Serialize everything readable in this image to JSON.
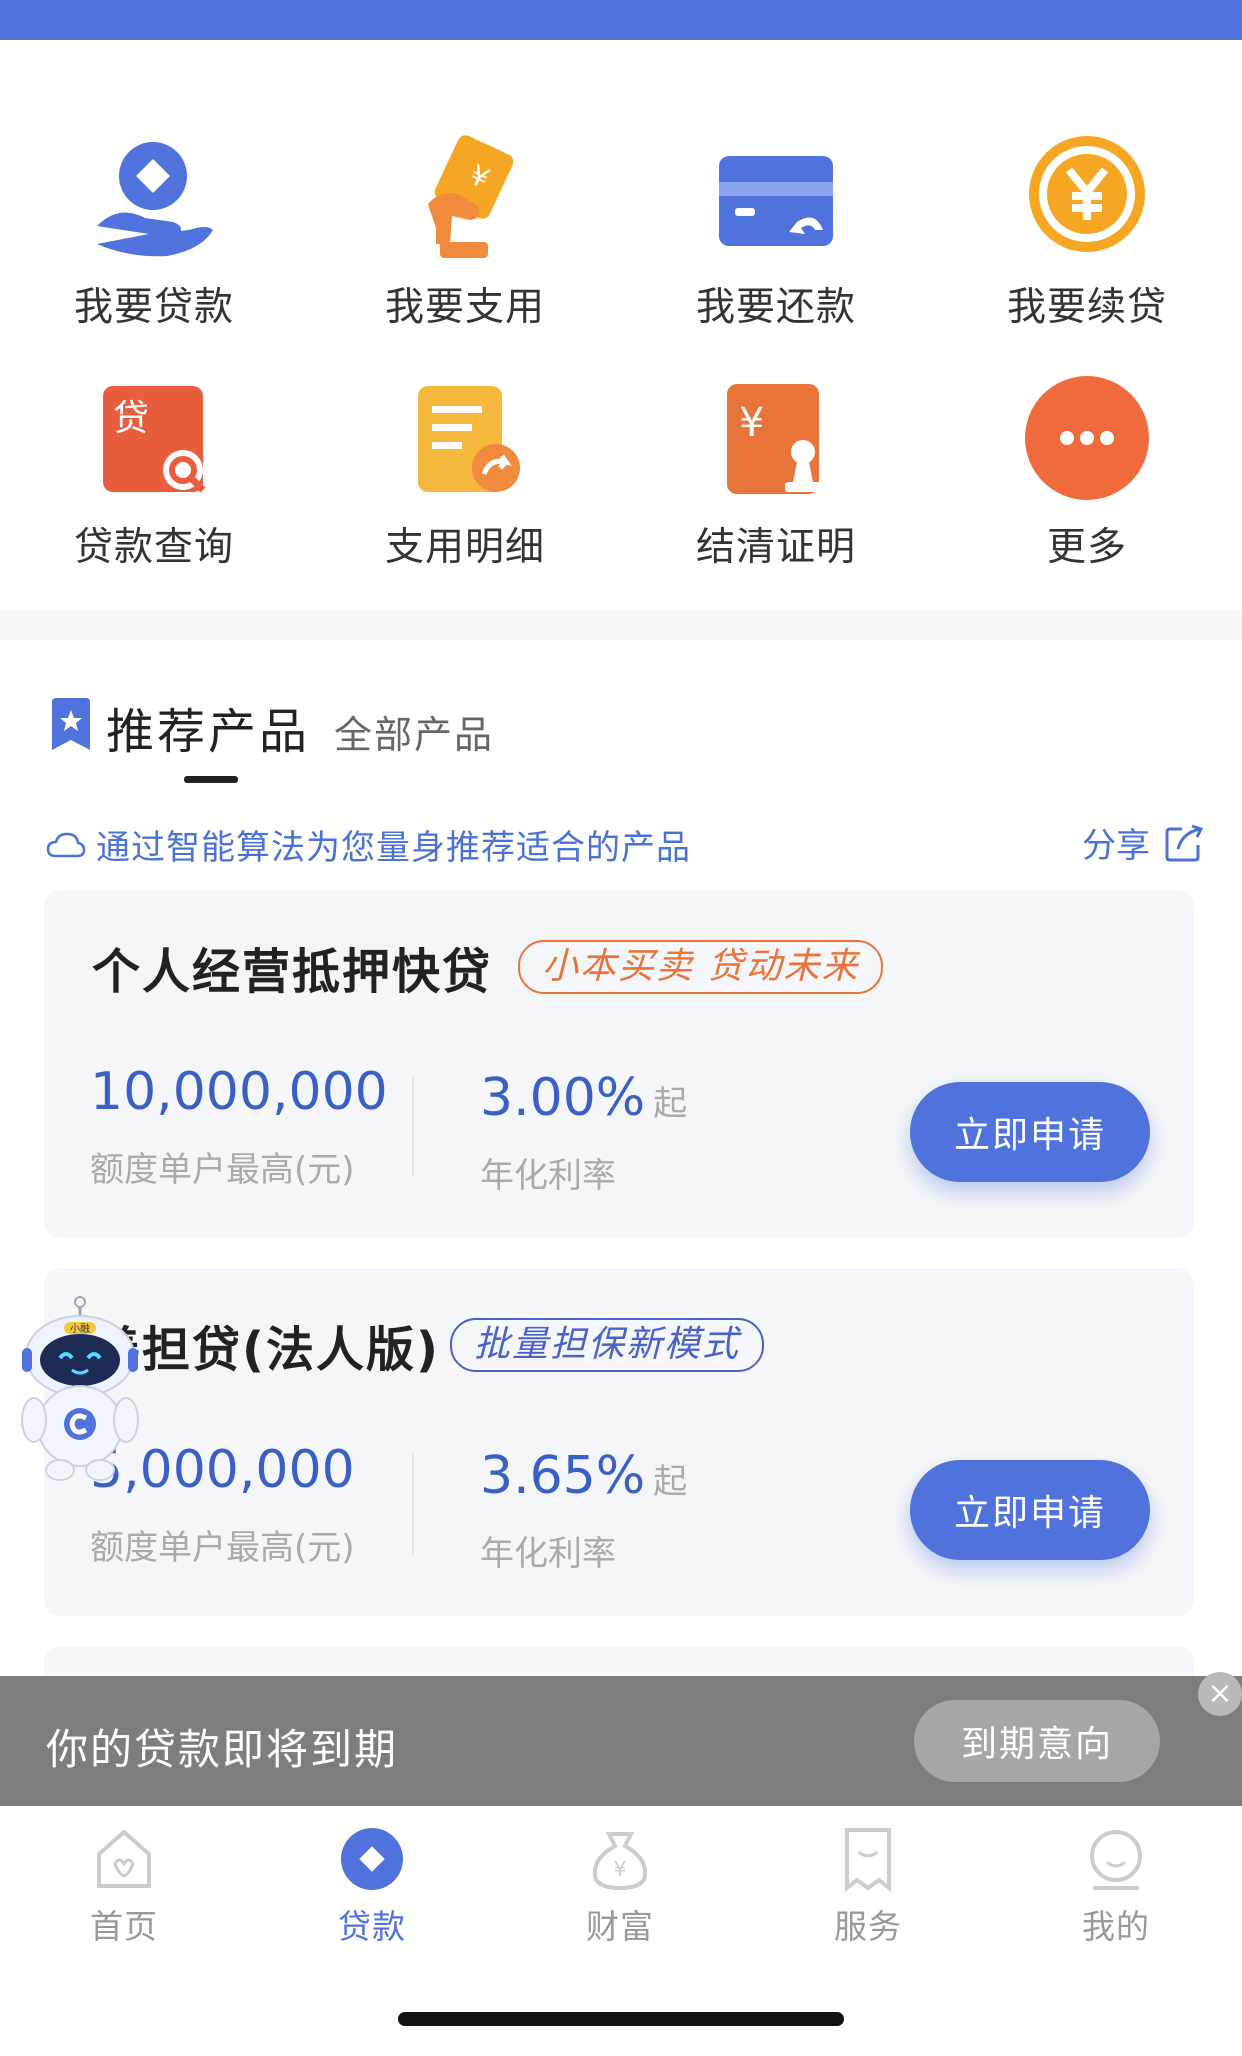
{
  "grid": [
    {
      "label": "我要贷款",
      "icon": "loan-hand-icon"
    },
    {
      "label": "我要支用",
      "icon": "withdraw-card-icon"
    },
    {
      "label": "我要还款",
      "icon": "repay-card-icon"
    },
    {
      "label": "我要续贷",
      "icon": "renew-yen-coin-icon"
    },
    {
      "label": "贷款查询",
      "icon": "loan-search-icon"
    },
    {
      "label": "支用明细",
      "icon": "usage-detail-icon"
    },
    {
      "label": "结清证明",
      "icon": "settlement-certificate-icon"
    },
    {
      "label": "更多",
      "icon": "more-icon"
    }
  ],
  "section": {
    "title": "推荐产品",
    "alt_tab": "全部产品",
    "hint": "通过智能算法为您量身推荐适合的产品",
    "share": "分享"
  },
  "products": [
    {
      "name": "个人经营抵押快贷",
      "tag": "小本买卖 贷动未来",
      "amount": "10,000,000",
      "amount_label": "额度单户最高(元)",
      "rate": "3.00%",
      "rate_suffix": "起",
      "rate_label": "年化利率",
      "apply": "立即申请"
    },
    {
      "name": "善担贷(法人版)",
      "tag": "批量担保新模式",
      "amount": "5,000,000",
      "amount_label": "额度单户最高(元)",
      "rate": "3.65%",
      "rate_suffix": "起",
      "rate_label": "年化利率",
      "apply": "立即申请"
    }
  ],
  "banner": {
    "message": "你的贷款即将到期",
    "action": "到期意向",
    "close": "×"
  },
  "tabs": [
    {
      "label": "首页",
      "icon": "home-icon",
      "active": false
    },
    {
      "label": "贷款",
      "icon": "loan-diamond-icon",
      "active": true
    },
    {
      "label": "财富",
      "icon": "wealth-bag-icon",
      "active": false
    },
    {
      "label": "服务",
      "icon": "service-icon",
      "active": false
    },
    {
      "label": "我的",
      "icon": "profile-icon",
      "active": false
    }
  ],
  "mascot_badge": "小融",
  "colors": {
    "primary": "#4f72dc",
    "orange": "#f08a3c",
    "tag_orange": "#e8743a",
    "tag_blue": "#4a62c8"
  }
}
